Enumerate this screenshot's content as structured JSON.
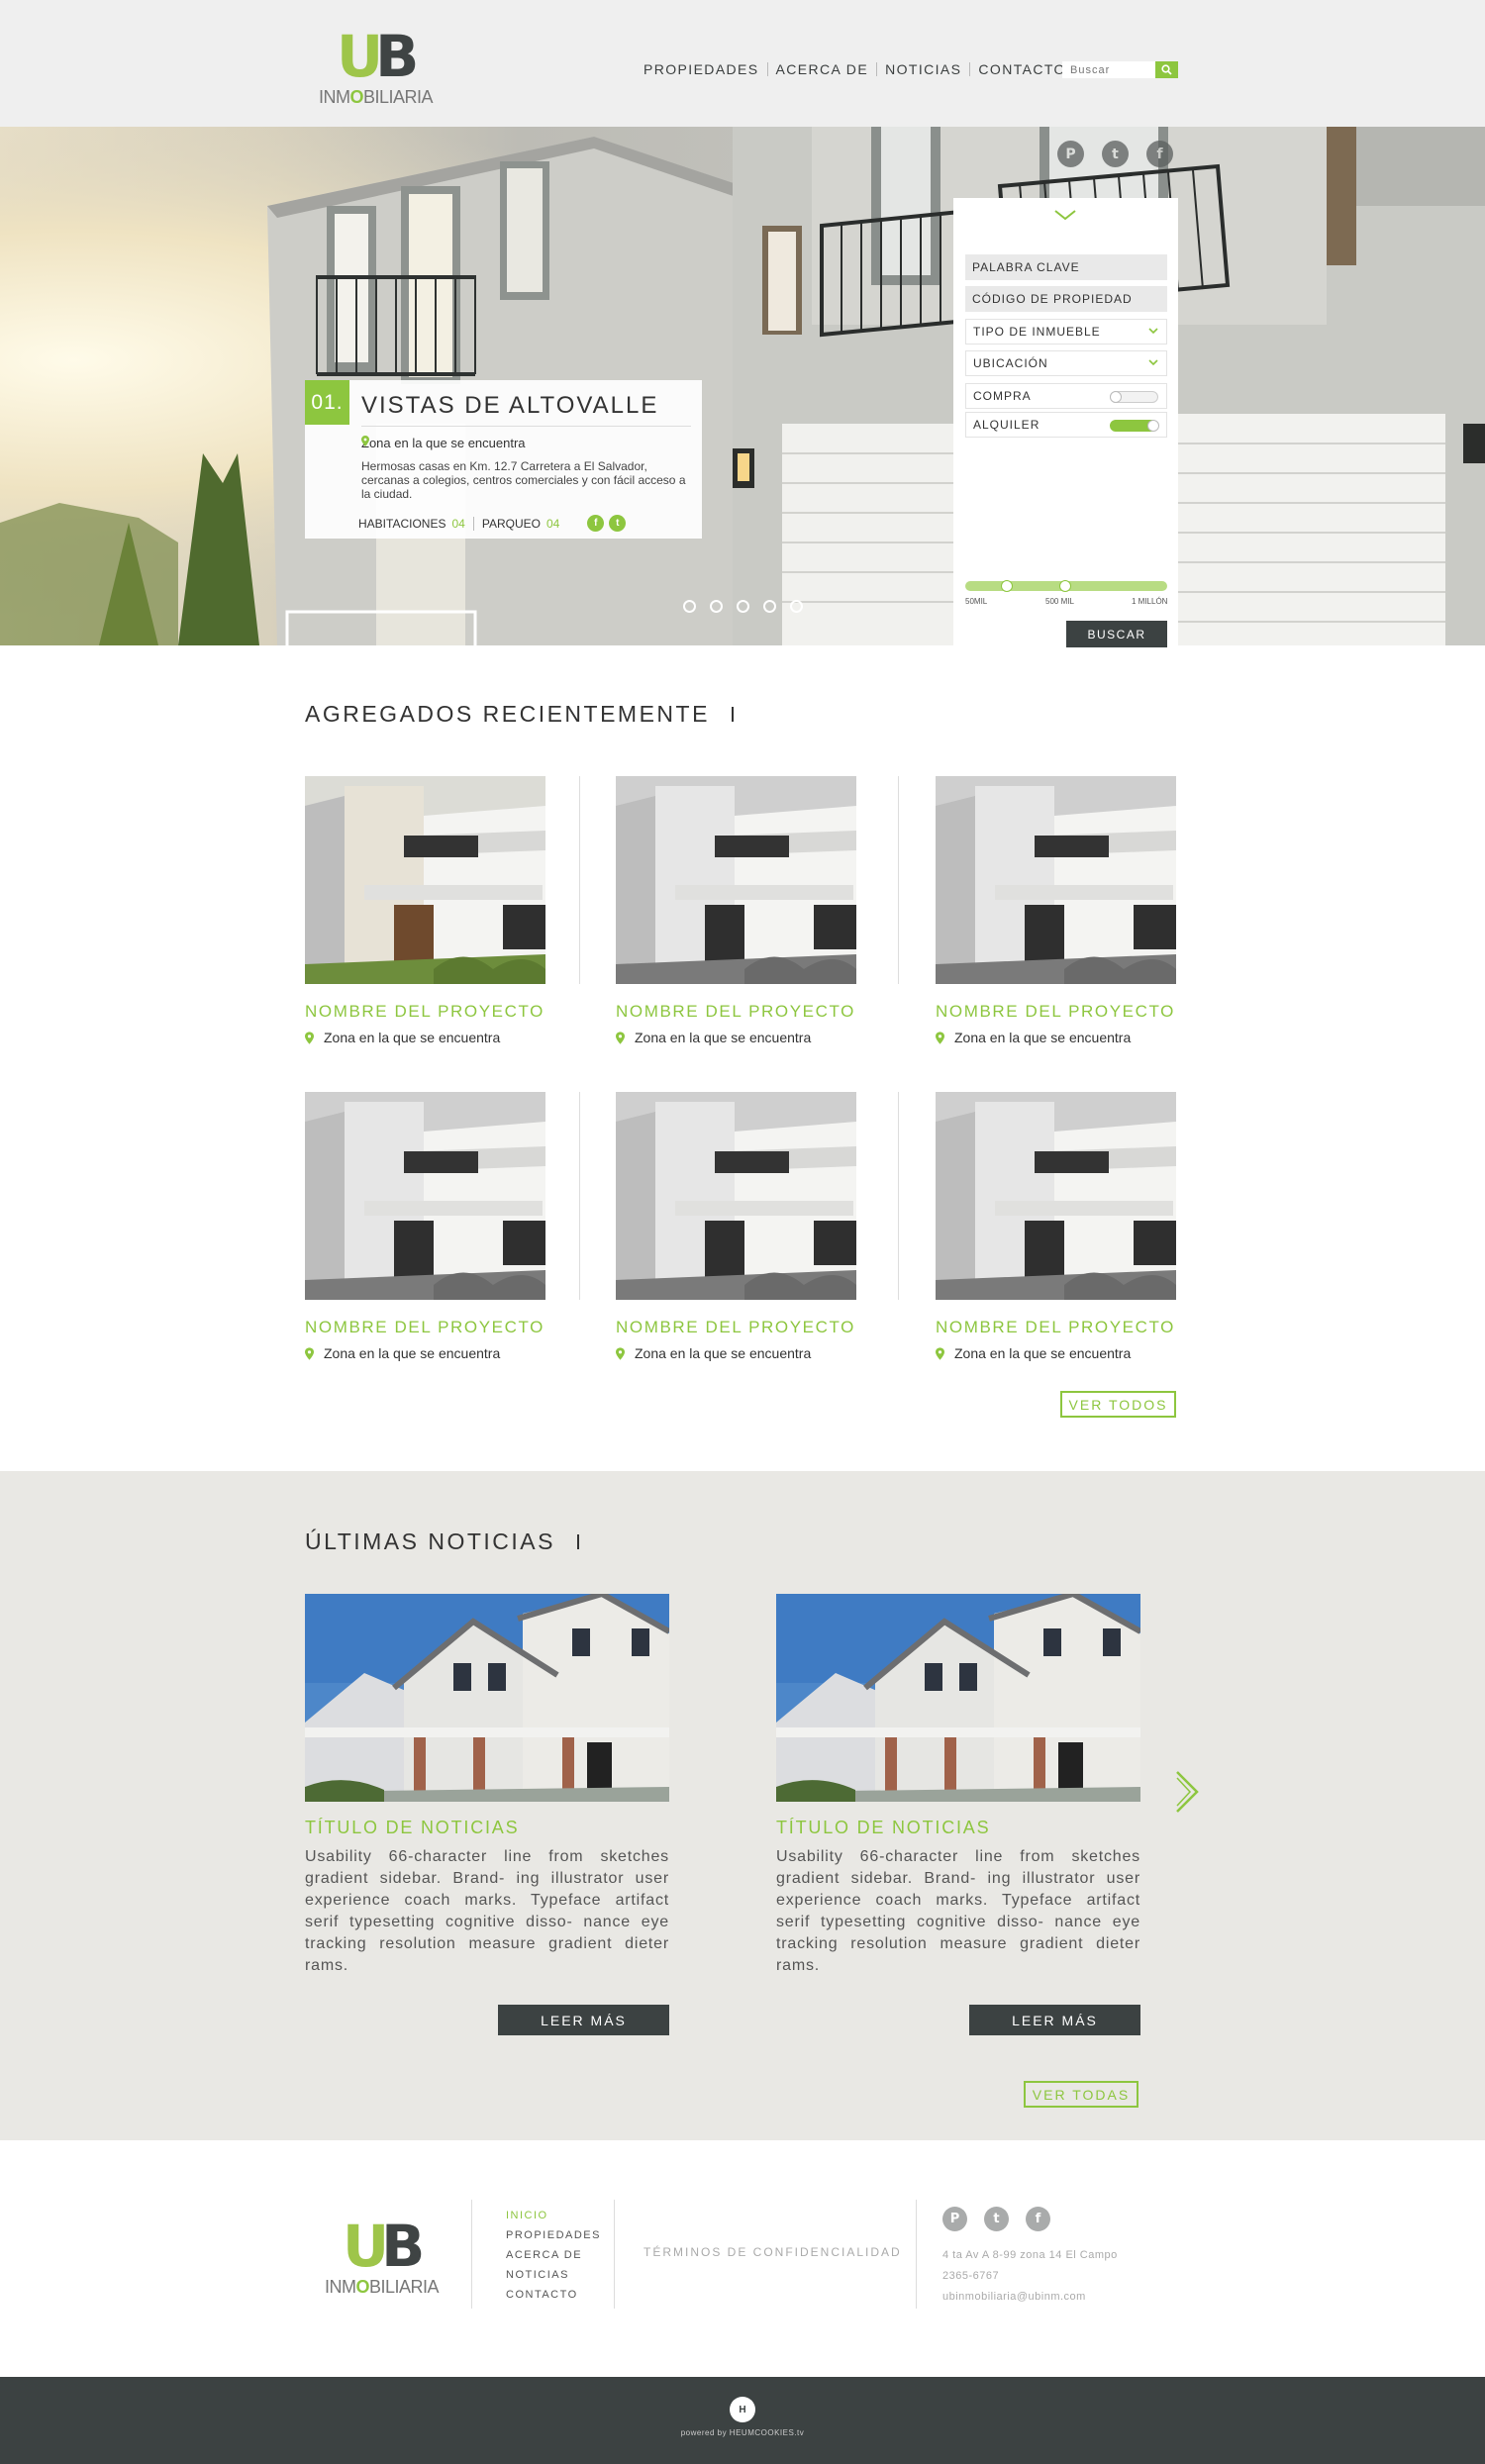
{
  "header": {
    "logo_letters": [
      "U",
      "B"
    ],
    "logo_text_pre": "INM",
    "logo_text_o": "O",
    "logo_text_post": "BILIARIA",
    "nav": [
      "PROPIEDADES",
      "ACERCA DE",
      "NOTICIAS",
      "CONTACTO"
    ],
    "search_placeholder": "Buscar"
  },
  "hero": {
    "socials": [
      "pinterest-icon",
      "twitter-icon",
      "facebook-icon"
    ],
    "feature": {
      "number": "01.",
      "title": "VISTAS DE ALTOVALLE",
      "zone": "Zona en la que se encuentra",
      "description": "Hermosas casas en Km. 12.7 Carretera a El Salvador, cercanas a colegios, centros comerciales y con fácil acceso a la ciudad.",
      "rooms_label": "HABITACIONES",
      "rooms_value": "04",
      "parking_label": "PARQUEO",
      "parking_value": "04"
    },
    "slides_count": 5,
    "active_slide": 1
  },
  "search_panel": {
    "keyword": "PALABRA CLAVE",
    "property_code": "CÓDIGO DE PROPIEDAD",
    "property_type": "TIPO DE INMUEBLE",
    "location": "UBICACIÓN",
    "buy_label": "COMPRA",
    "buy_on": false,
    "rent_label": "ALQUILER",
    "rent_on": true,
    "price_min_label": "50MIL",
    "price_mid_label": "500 MIL",
    "price_max_label": "1 MILLÓN",
    "submit": "BUSCAR",
    "accent": "#8dc63f"
  },
  "recent": {
    "title": "AGREGADOS RECIENTEMENTE",
    "items": [
      {
        "name": "NOMBRE DEL PROYECTO",
        "zone": "Zona en la que se encuentra"
      },
      {
        "name": "NOMBRE DEL PROYECTO",
        "zone": "Zona en la que se encuentra"
      },
      {
        "name": "NOMBRE DEL PROYECTO",
        "zone": "Zona en la que se encuentra"
      },
      {
        "name": "NOMBRE DEL PROYECTO",
        "zone": "Zona en la que se encuentra"
      },
      {
        "name": "NOMBRE DEL PROYECTO",
        "zone": "Zona en la que se encuentra"
      },
      {
        "name": "NOMBRE DEL PROYECTO",
        "zone": "Zona en la que se encuentra"
      }
    ],
    "view_all": "VER TODOS"
  },
  "news": {
    "title": "ÚLTIMAS NOTICIAS",
    "items": [
      {
        "title": "TÍTULO DE NOTICIAS",
        "body": "Usability 66-character line from sketches gradient sidebar. Brand- ing illustrator user experience coach marks. Typeface artifact serif typesetting cognitive disso- nance eye tracking resolution measure gradient dieter rams.",
        "button": "LEER MÁS"
      },
      {
        "title": "TÍTULO DE NOTICIAS",
        "body": "Usability 66-character line from sketches gradient sidebar. Brand- ing illustrator user experience coach marks. Typeface artifact serif typesetting cognitive disso- nance eye tracking resolution measure gradient dieter rams.",
        "button": "LEER MÁS"
      }
    ],
    "view_all": "VER TODAS"
  },
  "footer": {
    "links": [
      "INICIO",
      "PROPIEDADES",
      "ACERCA DE",
      "NOTICIAS",
      "CONTACTO"
    ],
    "terms": "TÉRMINOS DE CONFIDENCIALIDAD",
    "socials": [
      "pinterest-icon",
      "twitter-icon",
      "facebook-icon"
    ],
    "address": "4 ta Av A 8-99 zona 14 El Campo",
    "phone": "2365-6767",
    "email": "ubinmobiliaria@ubinm.com",
    "powered": "powered by HEUMCOOKIES.tv"
  }
}
